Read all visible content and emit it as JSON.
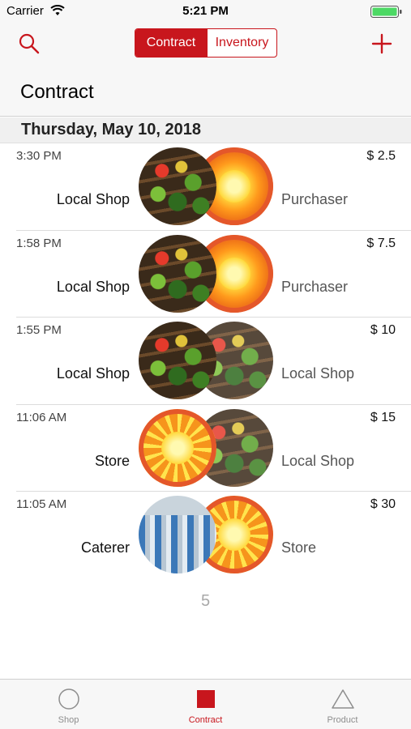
{
  "status": {
    "carrier": "Carrier",
    "time": "5:21 PM",
    "battery_color": "#4cd964"
  },
  "nav": {
    "segments": [
      "Contract",
      "Inventory"
    ],
    "selected_segment": "Contract",
    "title": "Contract",
    "accent_color": "#c8161d",
    "left_icon": "search-icon",
    "right_icon": "plus-icon"
  },
  "section": {
    "date": "Thursday, May 10, 2018"
  },
  "rows": [
    {
      "time": "3:30 PM",
      "amount": "$ 2.5",
      "from": "Local Shop",
      "to": "Purchaser",
      "from_image": "produce-stand",
      "to_image": "sun"
    },
    {
      "time": "1:58 PM",
      "amount": "$ 7.5",
      "from": "Local Shop",
      "to": "Purchaser",
      "from_image": "produce-stand",
      "to_image": "sun"
    },
    {
      "time": "1:55 PM",
      "amount": "$ 10",
      "from": "Local Shop",
      "to": "Local Shop",
      "from_image": "produce-stand",
      "to_image": "produce-stand"
    },
    {
      "time": "11:06 AM",
      "amount": "$ 15",
      "from": "Store",
      "to": "Local Shop",
      "from_image": "sun-burst",
      "to_image": "produce-stand"
    },
    {
      "time": "11:05 AM",
      "amount": "$ 30",
      "from": "Caterer",
      "to": "Store",
      "from_image": "factory-line",
      "to_image": "sun-burst"
    }
  ],
  "footer": {
    "count": "5"
  },
  "tabs": [
    {
      "label": "Shop",
      "icon": "circle-icon",
      "active": false
    },
    {
      "label": "Contract",
      "icon": "square-icon",
      "active": true
    },
    {
      "label": "Product",
      "icon": "triangle-icon",
      "active": false
    }
  ]
}
